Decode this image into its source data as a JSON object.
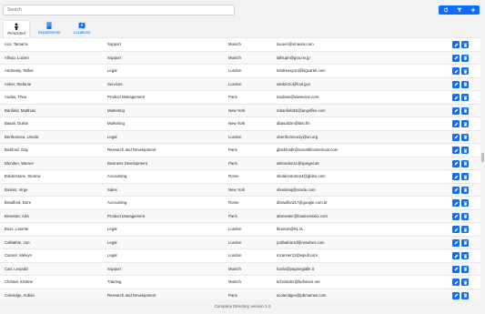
{
  "search": {
    "placeholder": "Search"
  },
  "toolbar": {
    "refresh_icon": "refresh-icon",
    "filter_icon": "filter-icon",
    "add_icon": "plus-icon",
    "accent": "#0d6efd"
  },
  "tabs": [
    {
      "label": "Personnel",
      "icon": "person-icon",
      "active": true
    },
    {
      "label": "Departments",
      "icon": "building-icon",
      "active": false
    },
    {
      "label": "Locations",
      "icon": "map-icon",
      "active": false
    }
  ],
  "rows": [
    {
      "name": "Aco, Tamarra",
      "dept": "Support",
      "loc": "Munich",
      "email": "tacoen@vinaora.com"
    },
    {
      "name": "Allsup, Lucien",
      "dept": "Support",
      "loc": "Munich",
      "email": "lallsupn@goo.ne.jp"
    },
    {
      "name": "Andreasy, Talbot",
      "dept": "Legal",
      "loc": "London",
      "email": "tandreasy1n@bigcartel.com"
    },
    {
      "name": "Anker, Stefanie",
      "dept": "Services",
      "loc": "London",
      "email": "sanker2o@fool.gov"
    },
    {
      "name": "Audas, Theo",
      "dept": "Product Management",
      "loc": "Paris",
      "email": "taudasn@wwwvine.com"
    },
    {
      "name": "Banfield, Matthias",
      "dept": "Marketing",
      "loc": "New York",
      "email": "mbanfield1b@angelfire.com"
    },
    {
      "name": "Basali, Dulsie",
      "dept": "Marketing",
      "loc": "New York",
      "email": "dbasali2m@last.fm"
    },
    {
      "name": "Berthonneu, Ursola",
      "dept": "Legal",
      "loc": "London",
      "email": "uberthonneu1y@un.org"
    },
    {
      "name": "Bickford, Gay",
      "dept": "Research and Development",
      "loc": "Paris",
      "email": "gbickfordk@scientificamerican.com"
    },
    {
      "name": "Blonden, Warner",
      "dept": "Business Development",
      "loc": "Paris",
      "email": "wblonden11@spiegel.de"
    },
    {
      "name": "Bolderstone, Stonnie",
      "dept": "Accounting",
      "loc": "Rome",
      "email": "sbolderstone24@globo.com"
    },
    {
      "name": "Boxtes, Virge",
      "dept": "Sales",
      "loc": "New York",
      "email": "vboxtesq@oracle.com"
    },
    {
      "name": "Braidford, Dore",
      "dept": "Accounting",
      "loc": "Rome",
      "email": "dbraidford17@google.com.br"
    },
    {
      "name": "Brewster, Ailis",
      "dept": "Product Management",
      "loc": "Paris",
      "email": "abrewster@businessxkx.com"
    },
    {
      "name": "Buss, Lanette",
      "dept": "Legal",
      "loc": "London",
      "email": "lbuss15@51.la"
    },
    {
      "name": "Calbathie, Jon",
      "dept": "Legal",
      "loc": "London",
      "email": "jcalbathie1d@netvibes.com"
    },
    {
      "name": "Canner, Melvyn",
      "dept": "Legal",
      "loc": "London",
      "email": "mcanner12@wpull.com"
    },
    {
      "name": "Carl, Leopold",
      "dept": "Support",
      "loc": "Munich",
      "email": "lcarlo@paginegialle.it"
    },
    {
      "name": "Christal, Kristine",
      "dept": "Training",
      "loc": "Munich",
      "email": "kchristal1r@behance.net"
    },
    {
      "name": "Coleridge, Ardisa",
      "dept": "Research and Development",
      "loc": "Paris",
      "email": "acoleridgev@pbmames.com"
    }
  ],
  "row_actions": {
    "edit_icon": "pencil-icon",
    "delete_icon": "trash-icon"
  },
  "footer": {
    "text": "Company Directory version 1.0"
  }
}
